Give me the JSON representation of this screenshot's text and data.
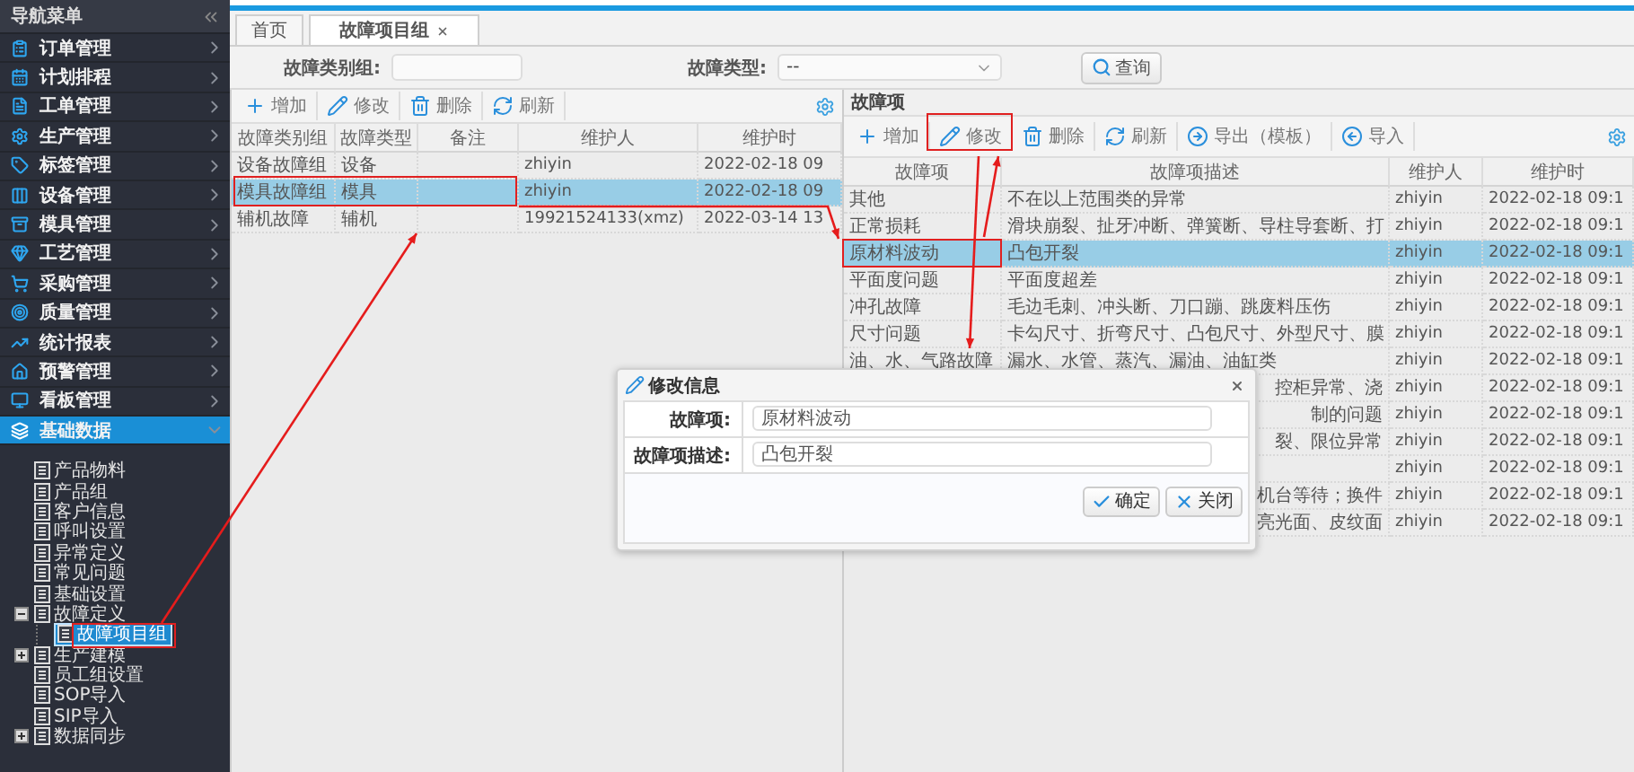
{
  "sidebar": {
    "title": "导航菜单",
    "menu": [
      {
        "label": "订单管理",
        "selected": false,
        "expanded": false
      },
      {
        "label": "计划排程",
        "selected": false,
        "expanded": false
      },
      {
        "label": "工单管理",
        "selected": false,
        "expanded": false
      },
      {
        "label": "生产管理",
        "selected": false,
        "expanded": false
      },
      {
        "label": "标签管理",
        "selected": false,
        "expanded": false
      },
      {
        "label": "设备管理",
        "selected": false,
        "expanded": false
      },
      {
        "label": "模具管理",
        "selected": false,
        "expanded": false
      },
      {
        "label": "工艺管理",
        "selected": false,
        "expanded": false
      },
      {
        "label": "采购管理",
        "selected": false,
        "expanded": false
      },
      {
        "label": "质量管理",
        "selected": false,
        "expanded": false
      },
      {
        "label": "统计报表",
        "selected": false,
        "expanded": false
      },
      {
        "label": "预警管理",
        "selected": false,
        "expanded": false
      },
      {
        "label": "看板管理",
        "selected": false,
        "expanded": false
      },
      {
        "label": "基础数据",
        "selected": true,
        "expanded": true
      }
    ],
    "tree": [
      {
        "label": "产品物料",
        "selected": false
      },
      {
        "label": "产品组",
        "selected": false
      },
      {
        "label": "客户信息",
        "selected": false
      },
      {
        "label": "呼叫设置",
        "selected": false
      },
      {
        "label": "异常定义",
        "selected": false
      },
      {
        "label": "常见问题",
        "selected": false
      },
      {
        "label": "基础设置",
        "selected": false
      },
      {
        "label": "故障定义",
        "selected": false,
        "expanded": true,
        "children": [
          {
            "label": "故障项目组",
            "selected": true
          }
        ]
      },
      {
        "label": "生产建模",
        "selected": false,
        "expanded": false
      },
      {
        "label": "员工组设置",
        "selected": false
      },
      {
        "label": "SOP导入",
        "selected": false
      },
      {
        "label": "SIP导入",
        "selected": false
      },
      {
        "label": "数据同步",
        "selected": false,
        "expanded": false
      }
    ]
  },
  "tabs": [
    {
      "label": "首页",
      "selected": false,
      "closable": false
    },
    {
      "label": "故障项目组",
      "selected": true,
      "closable": true
    }
  ],
  "filter": {
    "fields": [
      {
        "label": "故障类别组:",
        "kind": "text"
      },
      {
        "label": "故障类型:",
        "kind": "select",
        "value": "--"
      }
    ],
    "search_button": "查询"
  },
  "left_grid": {
    "toolbar": [
      {
        "label": "增加",
        "kind": "add"
      },
      {
        "label": "修改",
        "kind": "edit"
      },
      {
        "label": "删除",
        "kind": "delete"
      },
      {
        "label": "刷新",
        "kind": "refresh"
      }
    ],
    "columns": [
      "故障类别组",
      "故障类型",
      "备注",
      "维护人",
      "维护时"
    ],
    "rows": [
      {
        "selected": false,
        "cells": [
          "设备故障组",
          "设备",
          null,
          "zhiyin",
          "2022-02-18 09"
        ]
      },
      {
        "selected": true,
        "cells": [
          "模具故障组",
          "模具",
          null,
          "zhiyin",
          "2022-02-18 09"
        ]
      },
      {
        "selected": false,
        "cells": [
          "辅机故障",
          "辅机",
          null,
          "19921524133(xmz)",
          "2022-03-14 13"
        ]
      }
    ]
  },
  "right_grid": {
    "title": "故障项",
    "toolbar": [
      {
        "label": "增加",
        "kind": "add"
      },
      {
        "label": "修改",
        "kind": "edit"
      },
      {
        "label": "删除",
        "kind": "delete"
      },
      {
        "label": "刷新",
        "kind": "refresh"
      },
      {
        "label": "导出（模板）",
        "kind": "export"
      },
      {
        "label": "导入",
        "kind": "import"
      }
    ],
    "columns": [
      "故障项",
      "故障项描述",
      "维护人",
      "维护时"
    ],
    "rows": [
      {
        "selected": false,
        "covered": false,
        "cells": [
          "其他",
          "不在以上范围类的异常",
          "zhiyin",
          "2022-02-18 09:1"
        ]
      },
      {
        "selected": false,
        "covered": false,
        "cells": [
          "正常损耗",
          "滑块崩裂、扯牙冲断、弹簧断、导柱导套断、打",
          "zhiyin",
          "2022-02-18 09:1"
        ]
      },
      {
        "selected": true,
        "covered": false,
        "cells": [
          "原材料波动",
          "凸包开裂",
          "zhiyin",
          "2022-02-18 09:1"
        ]
      },
      {
        "selected": false,
        "covered": false,
        "cells": [
          "平面度问题",
          "平面度超差",
          "zhiyin",
          "2022-02-18 09:1"
        ]
      },
      {
        "selected": false,
        "covered": false,
        "cells": [
          "冲孔故障",
          "毛边毛刺、冲头断、刀口蹦、跳废料压伤",
          "zhiyin",
          "2022-02-18 09:1"
        ]
      },
      {
        "selected": false,
        "covered": false,
        "cells": [
          "尺寸问题",
          "卡勾尺寸、折弯尺寸、凸包尺寸、外型尺寸、膜",
          "zhiyin",
          "2022-02-18 09:1"
        ]
      },
      {
        "selected": false,
        "covered": false,
        "cells": [
          "油、水、气路故障",
          "漏水、水管、蒸汽、漏油、油缸类",
          "zhiyin",
          "2022-02-18 09:1"
        ]
      },
      {
        "selected": false,
        "covered": true,
        "cells": [
          "控柜异常、浇",
          "zhiyin",
          "2022-02-18 09:1"
        ]
      },
      {
        "selected": false,
        "covered": true,
        "cells": [
          "制的问题",
          "zhiyin",
          "2022-02-18 09:1"
        ]
      },
      {
        "selected": false,
        "covered": true,
        "cells": [
          "裂、限位异常",
          "zhiyin",
          "2022-02-18 09:1"
        ]
      },
      {
        "selected": false,
        "covered": true,
        "cells": [
          null,
          "zhiyin",
          "2022-02-18 09:1"
        ]
      },
      {
        "selected": false,
        "covered": true,
        "cells": [
          "机台等待；换件",
          "zhiyin",
          "2022-02-18 09:1"
        ]
      },
      {
        "selected": false,
        "covered": true,
        "cells": [
          "亮光面、皮纹面",
          "zhiyin",
          "2022-02-18 09:1"
        ]
      }
    ]
  },
  "dialog": {
    "title": "修改信息",
    "fields": [
      {
        "label": "故障项:",
        "value": "原材料波动"
      },
      {
        "label": "故障项描述:",
        "value": "凸包开裂"
      }
    ],
    "buttons": [
      {
        "label": "确定",
        "kind": "ok"
      },
      {
        "label": "关闭",
        "kind": "close"
      }
    ]
  }
}
